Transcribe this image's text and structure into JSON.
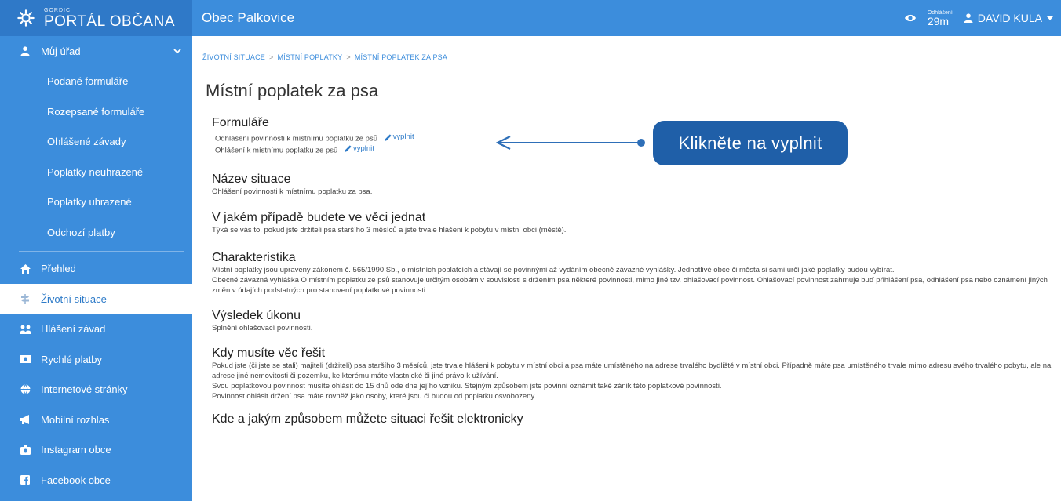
{
  "brand": {
    "small": "GORDIC",
    "name": "PORTÁL OBČANA"
  },
  "header": {
    "title": "Obec Palkovice",
    "logout_label": "Odhlášení",
    "logout_time": "29m",
    "user": "DAVID KULA"
  },
  "sidebar": {
    "group": "Můj úřad",
    "sub_items": [
      "Podané formuláře",
      "Rozepsané formuláře",
      "Ohlášené závady",
      "Poplatky neuhrazené",
      "Poplatky uhrazené",
      "Odchozí platby"
    ],
    "items": [
      {
        "label": "Přehled",
        "icon": "home-icon"
      },
      {
        "label": "Životní situace",
        "icon": "signpost-icon"
      },
      {
        "label": "Hlášení závad",
        "icon": "report-icon"
      },
      {
        "label": "Rychlé platby",
        "icon": "payment-icon"
      },
      {
        "label": "Internetové stránky",
        "icon": "globe-icon"
      },
      {
        "label": "Mobilní rozhlas",
        "icon": "megaphone-icon"
      },
      {
        "label": "Instagram obce",
        "icon": "camera-icon"
      },
      {
        "label": "Facebook obce",
        "icon": "facebook-icon"
      }
    ]
  },
  "breadcrumb": [
    "ŽIVOTNÍ SITUACE",
    "MÍSTNÍ POPLATKY",
    "MÍSTNÍ POPLATEK ZA PSA"
  ],
  "page_title": "Místní poplatek za psa",
  "forms": {
    "heading": "Formuláře",
    "items": [
      {
        "label": "Odhlášení povinnosti k místnímu poplatku ze psů",
        "action": "vyplnit"
      },
      {
        "label": "Ohlášení k místnímu poplatku ze psů",
        "action": "vyplnit"
      }
    ]
  },
  "callout": "Klikněte na vyplnit",
  "sections": [
    {
      "heading": "Název situace",
      "lines": [
        "Ohlášení povinnosti k místnímu poplatku za psa."
      ]
    },
    {
      "heading": "V jakém případě budete ve věci jednat",
      "lines": [
        "Týká se vás to, pokud jste držiteli psa staršího 3 měsíců a jste trvale hlášeni k pobytu v místní obci (městě)."
      ]
    },
    {
      "heading": "Charakteristika",
      "lines": [
        "Místní poplatky jsou upraveny zákonem č. 565/1990 Sb., o místních poplatcích a stávají se povinnými až vydáním obecně závazné vyhlášky. Jednotlivé obce či města si sami určí jaké poplatky budou vybírat.",
        "Obecně závazná vyhláška O místním poplatku ze psů stanovuje určitým osobám v souvislosti s držením psa některé povinnosti, mimo jiné tzv. ohlašovací povinnost. Ohlašovací povinnost zahrnuje buď přihlášení psa, odhlášení psa nebo oznámení jiných změn v údajích podstatných pro stanovení poplatkové povinnosti."
      ]
    },
    {
      "heading": "Výsledek úkonu",
      "lines": [
        "Splnění ohlašovací povinnosti."
      ]
    },
    {
      "heading": "Kdy musíte věc řešit",
      "lines": [
        "Pokud jste (či jste se stali) majiteli (držiteli) psa staršího 3 měsíců, jste trvale hlášeni k pobytu v místní obci a psa máte umístěného na adrese trvalého bydliště v místní obci. Případně máte psa umístěného trvale mimo adresu svého trvalého pobytu, ale na adrese jiné nemovitosti či pozemku, ke kterému máte vlastnické či jiné právo k užívání.",
        "Svou poplatkovou povinnost musíte ohlásit do 15 dnů ode dne jejího vzniku. Stejným způsobem jste povinni oznámit také zánik této poplatkové povinnosti.",
        "Povinnost ohlásit držení psa máte rovněž jako osoby, které jsou či budou od poplatku osvobozeny."
      ]
    },
    {
      "heading": "Kde a jakým způsobem můžete situaci řešit elektronicky",
      "lines": []
    }
  ]
}
